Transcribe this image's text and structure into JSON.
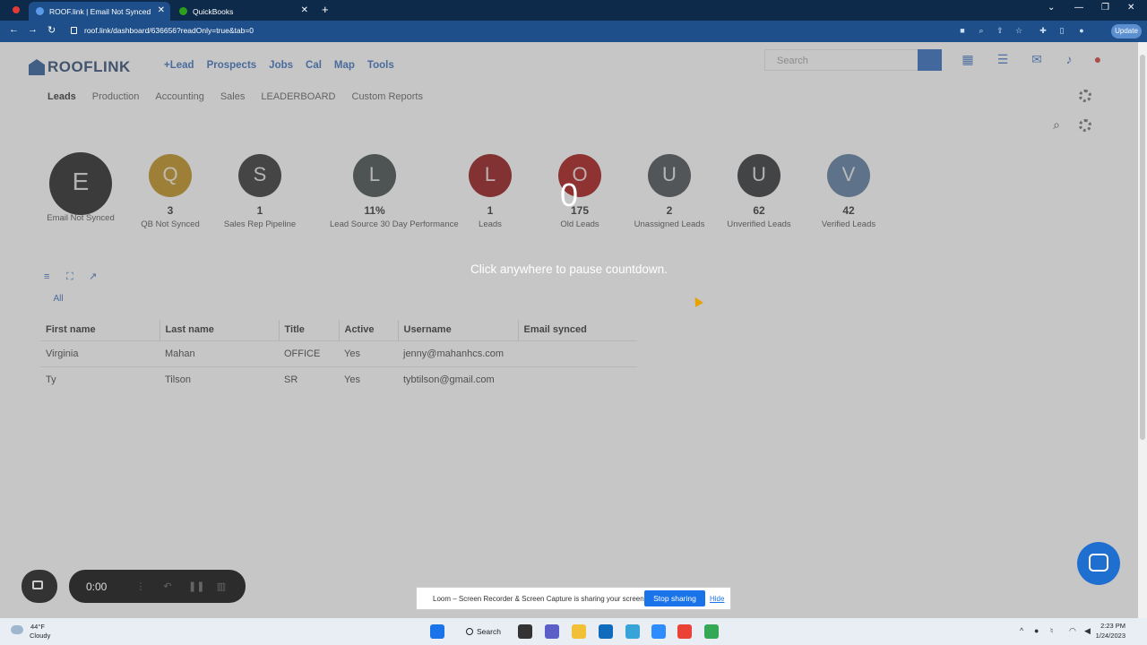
{
  "browser": {
    "tabs": [
      {
        "title": "ROOF.link | Email Not Synced",
        "active": true
      },
      {
        "title": "QuickBooks",
        "active": false
      }
    ],
    "url": "roof.link/dashboard/636656?readOnly=true&tab=0",
    "update_label": "Update"
  },
  "app": {
    "brand": "ROOFLINK",
    "nav": [
      "+Lead",
      "Prospects",
      "Jobs",
      "Cal",
      "Map",
      "Tools"
    ],
    "search_placeholder": "Search",
    "subtabs": [
      "Leads",
      "Production",
      "Accounting",
      "Sales",
      "LEADERBOARD",
      "Custom Reports"
    ],
    "kpis": [
      {
        "letter": "E",
        "value": "",
        "label": "Email Not Synced",
        "color": "#111111"
      },
      {
        "letter": "Q",
        "value": "3",
        "label": "QB Not Synced",
        "color": "#b8860b"
      },
      {
        "letter": "S",
        "value": "1",
        "label": "Sales Rep Pipeline",
        "color": "#222222"
      },
      {
        "letter": "L",
        "value": "11%",
        "label": "Lead Source 30 Day Performance",
        "color": "#2f3b3a"
      },
      {
        "letter": "L",
        "value": "1",
        "label": "Leads",
        "color": "#8b0000"
      },
      {
        "letter": "O",
        "value": "175",
        "label": "Old Leads",
        "color": "#a00000"
      },
      {
        "letter": "U",
        "value": "2",
        "label": "Unassigned Leads",
        "color": "#3a3f44"
      },
      {
        "letter": "U",
        "value": "62",
        "label": "Unverified Leads",
        "color": "#1c1f24"
      },
      {
        "letter": "V",
        "value": "42",
        "label": "Verified Leads",
        "color": "#4d6f96"
      }
    ],
    "filter_tab": "All",
    "table": {
      "columns": [
        "First name",
        "Last name",
        "Title",
        "Active",
        "Username",
        "Email synced"
      ],
      "rows": [
        [
          "Virginia",
          "Mahan",
          "OFFICE",
          "Yes",
          "jenny@mahanhcs.com",
          ""
        ],
        [
          "Ty",
          "Tilson",
          "SR",
          "Yes",
          "tybtilson@gmail.com",
          ""
        ]
      ]
    }
  },
  "overlay": {
    "countdown": "0",
    "message": "Click anywhere to pause countdown."
  },
  "loom": {
    "timer": "0:00",
    "share_message": "Loom – Screen Recorder & Screen Capture is sharing your screen.",
    "stop_label": "Stop sharing",
    "hide_label": "Hide"
  },
  "taskbar": {
    "temperature": "44°F",
    "condition": "Cloudy",
    "search_label": "Search",
    "time": "2:23 PM",
    "date": "1/24/2023"
  }
}
